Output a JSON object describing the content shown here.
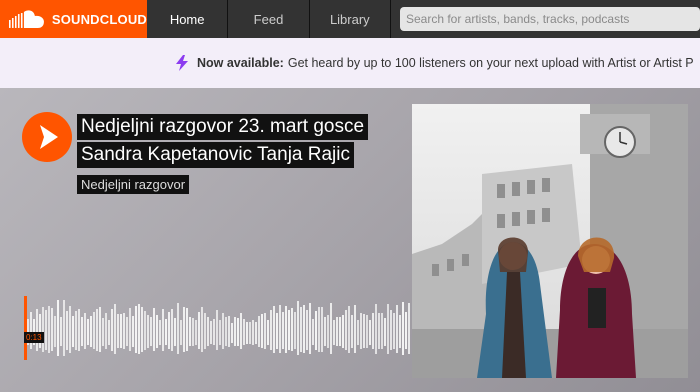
{
  "header": {
    "logo_text": "SOUNDCLOUD",
    "nav": [
      {
        "label": "Home"
      },
      {
        "label": "Feed"
      },
      {
        "label": "Library"
      }
    ],
    "search_placeholder": "Search for artists, bands, tracks, podcasts"
  },
  "banner": {
    "strong": "Now available:",
    "text": "Get heard by up to 100 listeners on your next upload with Artist or Artist P"
  },
  "track": {
    "title_line1": "Nedjeljni razgovor 23. mart gosce",
    "title_line2": "Sandra Kapetanovic  Tanja Rajic",
    "uploader": "Nedjeljni razgovor",
    "current_time": "0:13",
    "progress_fraction": 0.008
  },
  "colors": {
    "brand": "#ff5500",
    "header_bg": "#333333",
    "banner_bg": "#f3eef9"
  },
  "icons": {
    "logo": "soundcloud-cloud-icon",
    "banner": "lightning-bolt-icon",
    "play": "play-icon"
  }
}
